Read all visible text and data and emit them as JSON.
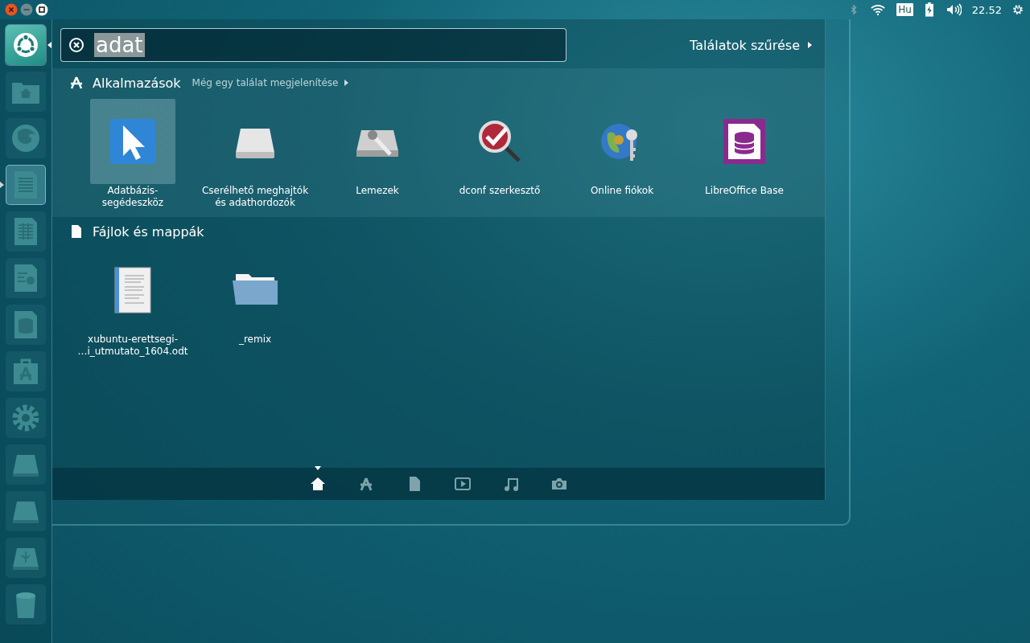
{
  "window_controls": [
    {
      "kind": "close"
    },
    {
      "kind": "minimize"
    },
    {
      "kind": "maximize"
    }
  ],
  "indicators": {
    "keyboard": "Hu",
    "clock": "22.52"
  },
  "launcher": {
    "items": [
      {
        "kind": "dash",
        "running": false
      },
      {
        "kind": "home",
        "running": false
      },
      {
        "kind": "browser",
        "running": false
      },
      {
        "kind": "writer",
        "running": true
      },
      {
        "kind": "calc",
        "running": false
      },
      {
        "kind": "impress",
        "running": false
      },
      {
        "kind": "base",
        "running": false
      },
      {
        "kind": "software",
        "running": false
      },
      {
        "kind": "settings",
        "running": false
      },
      {
        "kind": "drive",
        "running": false
      },
      {
        "kind": "drive",
        "running": false
      },
      {
        "kind": "usb",
        "running": false
      },
      {
        "kind": "trash",
        "running": false
      }
    ]
  },
  "search": {
    "value": "adat"
  },
  "filter": "Találatok szűrése",
  "categories": [
    {
      "kind": "apps",
      "title": "Alkalmazások",
      "more": "Még egy találat megjelenítése",
      "results": [
        {
          "kind": "pointer",
          "label": "Adatbázis-\nsegédeszköz",
          "selected": true
        },
        {
          "kind": "removable",
          "label": "Cserélhető meghajtók\nés adathordozók",
          "selected": false
        },
        {
          "kind": "disks",
          "label": "Lemezek",
          "selected": false
        },
        {
          "kind": "dconf",
          "label": "dconf szerkesztő",
          "selected": false
        },
        {
          "kind": "accounts",
          "label": "Online fiókok",
          "selected": false
        },
        {
          "kind": "base",
          "label": "LibreOffice Base",
          "selected": false
        }
      ]
    },
    {
      "kind": "files",
      "title": "Fájlok és mappák",
      "results": [
        {
          "kind": "document",
          "label": "xubuntu-erettsegi-\n…i_utmutato_1604.odt",
          "selected": false
        },
        {
          "kind": "folder",
          "label": "_remix",
          "selected": false
        }
      ]
    }
  ],
  "lenses": [
    {
      "kind": "home",
      "selected": true
    },
    {
      "kind": "apps",
      "selected": false
    },
    {
      "kind": "files",
      "selected": false
    },
    {
      "kind": "video",
      "selected": false
    },
    {
      "kind": "music",
      "selected": false
    },
    {
      "kind": "photo",
      "selected": false
    }
  ]
}
